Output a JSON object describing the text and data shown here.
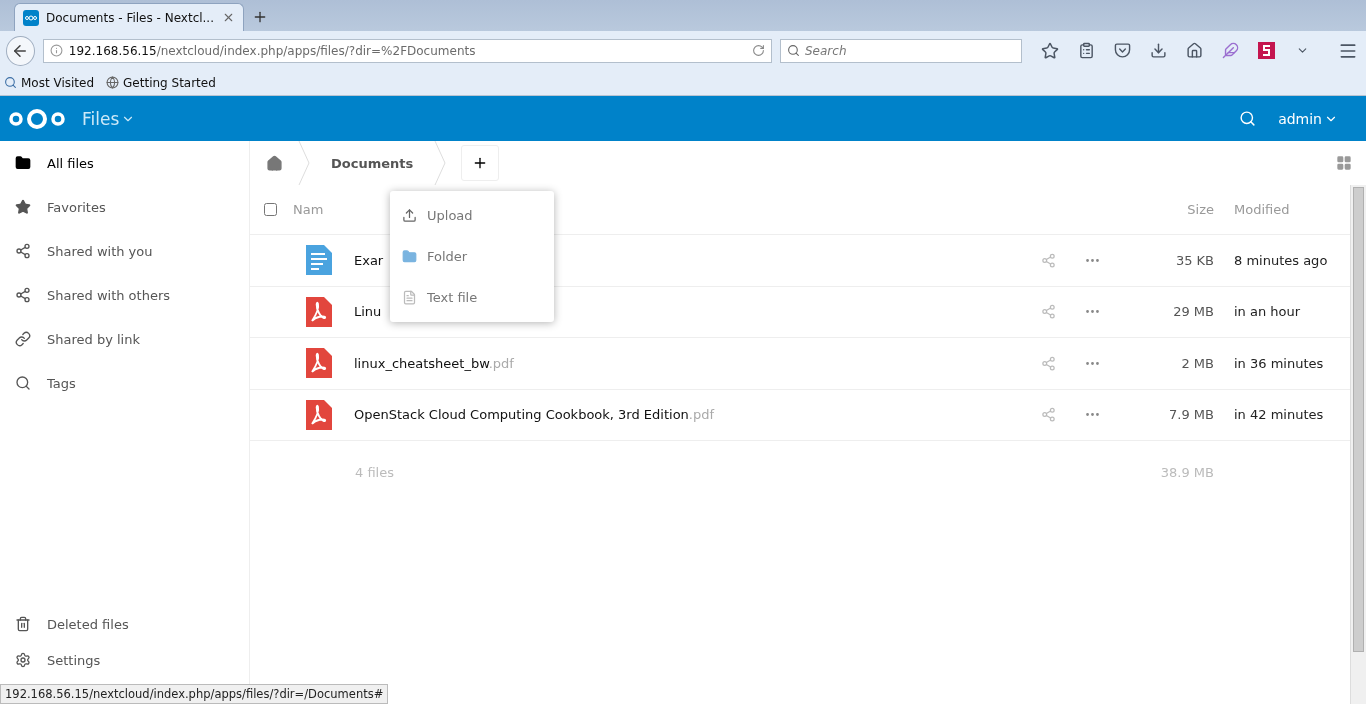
{
  "browser": {
    "tab": {
      "title": "Documents - Files - Nextcl...",
      "selected": true
    },
    "address": {
      "host": "192.168.56.15",
      "path": "/nextcloud/index.php/apps/files/?dir=%2FDocuments"
    },
    "search": {
      "placeholder": "Search"
    },
    "bookmarks": [
      "Most Visited",
      "Getting Started"
    ],
    "status_url": "192.168.56.15/nextcloud/index.php/apps/files/?dir=/Documents#"
  },
  "app": {
    "name": "Files",
    "user": "admin"
  },
  "sidebar": {
    "items": [
      {
        "label": "All files",
        "selected": true
      },
      {
        "label": "Favorites",
        "selected": false
      },
      {
        "label": "Shared with you",
        "selected": false
      },
      {
        "label": "Shared with others",
        "selected": false
      },
      {
        "label": "Shared by link",
        "selected": false
      },
      {
        "label": "Tags",
        "selected": false
      }
    ],
    "bottom": [
      "Deleted files",
      "Settings"
    ]
  },
  "breadcrumb": [
    "Documents"
  ],
  "new_menu": [
    "Upload",
    "Folder",
    "Text file"
  ],
  "table": {
    "select_all": {
      "checked": false
    },
    "columns": [
      "Nam",
      "Size",
      "Modified"
    ],
    "rows": [
      {
        "name": "Exar",
        "ext": "",
        "kind": "text",
        "size": "35 KB",
        "modified": "8 minutes ago"
      },
      {
        "name": "Linu",
        "ext": "",
        "kind": "pdf",
        "size": "29 MB",
        "modified": "in an hour"
      },
      {
        "name": "linux_cheatsheet_bw",
        "ext": ".pdf",
        "kind": "pdf",
        "size": "2 MB",
        "modified": "in 36 minutes"
      },
      {
        "name": "OpenStack Cloud Computing Cookbook, 3rd Edition",
        "ext": ".pdf",
        "kind": "pdf",
        "size": "7.9 MB",
        "modified": "in 42 minutes"
      }
    ],
    "summary": {
      "count": "4 files",
      "size": "38.9 MB"
    }
  }
}
